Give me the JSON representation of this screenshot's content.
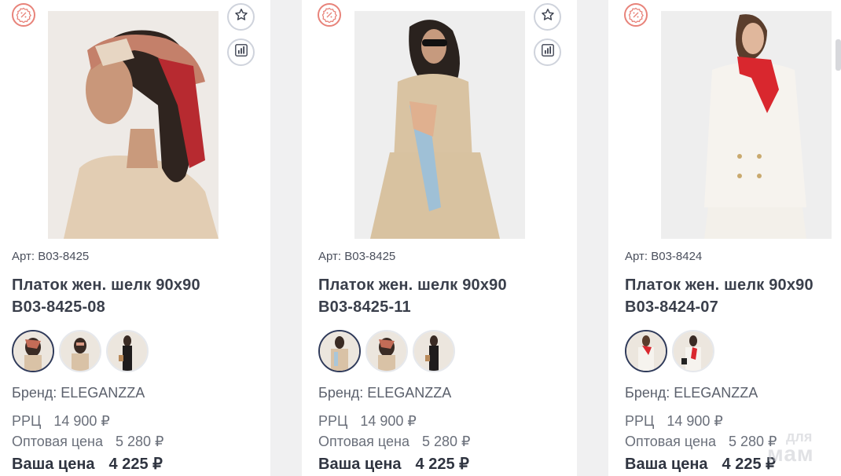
{
  "colors": {
    "page_bg": "#f0f0f1",
    "card_bg": "#ffffff",
    "promo_accent": "#e8837a",
    "active_swatch_border": "#2f3a5a"
  },
  "icons": {
    "promo": "percent-badge-icon",
    "favorite": "star-icon",
    "compare": "bar-chart-icon"
  },
  "products": [
    {
      "art": "Арт: B03-8425",
      "title_line1": "Платок жен. шелк 90х90",
      "title_line2": "B03-8425-08",
      "brand": "Бренд: ELEGANZZA",
      "rrc_label": "РРЦ",
      "rrc_value": "14 900 ₽",
      "wholesale_label": "Оптовая цена",
      "wholesale_value": "5 280 ₽",
      "your_label": "Ваша цена",
      "your_value": "4 225 ₽",
      "swatch_count": 3
    },
    {
      "art": "Арт: B03-8425",
      "title_line1": "Платок жен. шелк 90х90",
      "title_line2": "B03-8425-11",
      "brand": "Бренд: ELEGANZZA",
      "rrc_label": "РРЦ",
      "rrc_value": "14 900 ₽",
      "wholesale_label": "Оптовая цена",
      "wholesale_value": "5 280 ₽",
      "your_label": "Ваша цена",
      "your_value": "4 225 ₽",
      "swatch_count": 3
    },
    {
      "art": "Арт: B03-8424",
      "title_line1": "Платок жен. шелк 90х90",
      "title_line2": "B03-8424-07",
      "brand": "Бренд: ELEGANZZA",
      "rrc_label": "РРЦ",
      "rrc_value": "14 900 ₽",
      "wholesale_label": "Оптовая цена",
      "wholesale_value": "5 280 ₽",
      "your_label": "Ваша цена",
      "your_value": "4 225 ₽",
      "swatch_count": 2
    }
  ],
  "watermark": {
    "line1": "для",
    "line2": "мам"
  }
}
